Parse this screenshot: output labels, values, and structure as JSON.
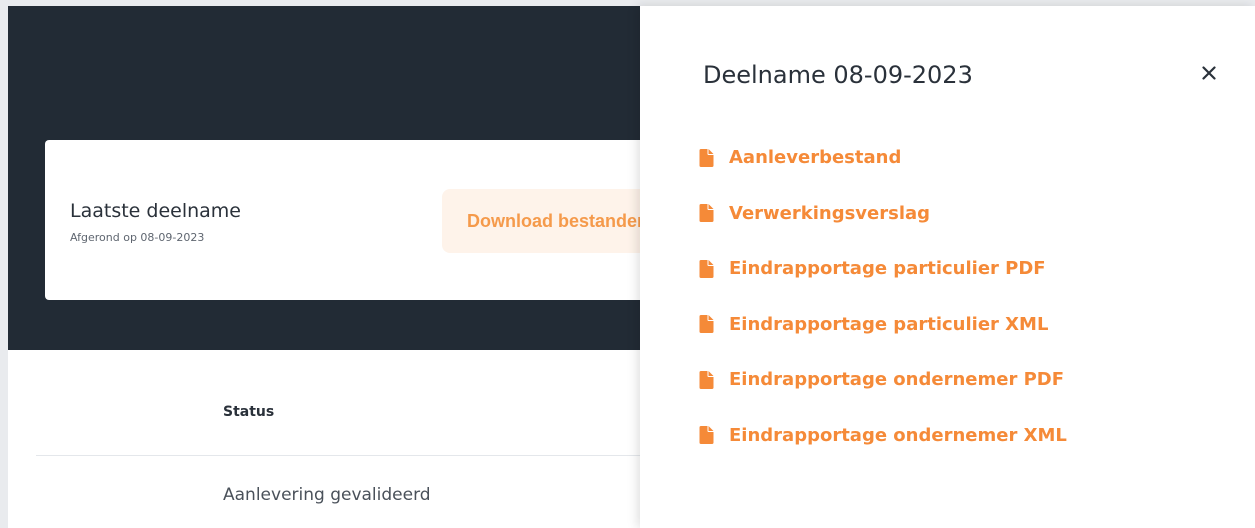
{
  "background_card": {
    "title": "Laatste deelname",
    "subtitle": "Afgerond op 08-09-2023",
    "download_label": "Download bestanden"
  },
  "table": {
    "header_status": "Status",
    "rows": [
      {
        "status": "Aanlevering gevalideerd"
      }
    ]
  },
  "panel": {
    "title": "Deelname 08-09-2023",
    "close_icon": "close-icon",
    "documents": [
      {
        "label": "Aanleverbestand",
        "icon": "file-icon"
      },
      {
        "label": "Verwerkingsverslag",
        "icon": "file-icon"
      },
      {
        "label": "Eindrapportage particulier PDF",
        "icon": "file-icon"
      },
      {
        "label": "Eindrapportage particulier XML",
        "icon": "file-icon"
      },
      {
        "label": "Eindrapportage ondernemer PDF",
        "icon": "file-icon"
      },
      {
        "label": "Eindrapportage ondernemer XML",
        "icon": "file-icon"
      }
    ]
  },
  "colors": {
    "accent": "#f58a38",
    "header_bg": "#222b35",
    "button_bg": "#fef3ea"
  }
}
